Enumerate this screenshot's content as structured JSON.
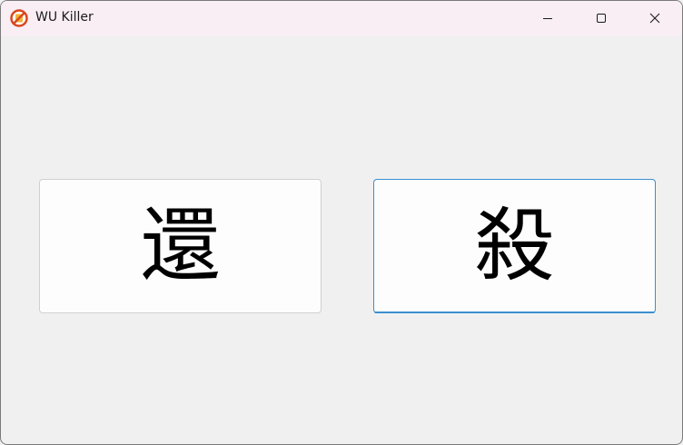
{
  "window": {
    "title": "WU Killer",
    "icon": "no-symbol-icon",
    "controls": {
      "minimize": "minimize-icon",
      "maximize": "maximize-icon",
      "close": "close-icon"
    }
  },
  "buttons": {
    "return_label": "還",
    "kill_label": "殺"
  },
  "colors": {
    "titlebar": "#f8eef3",
    "accent": "#3c8fd0",
    "icon_red": "#d9461f"
  }
}
